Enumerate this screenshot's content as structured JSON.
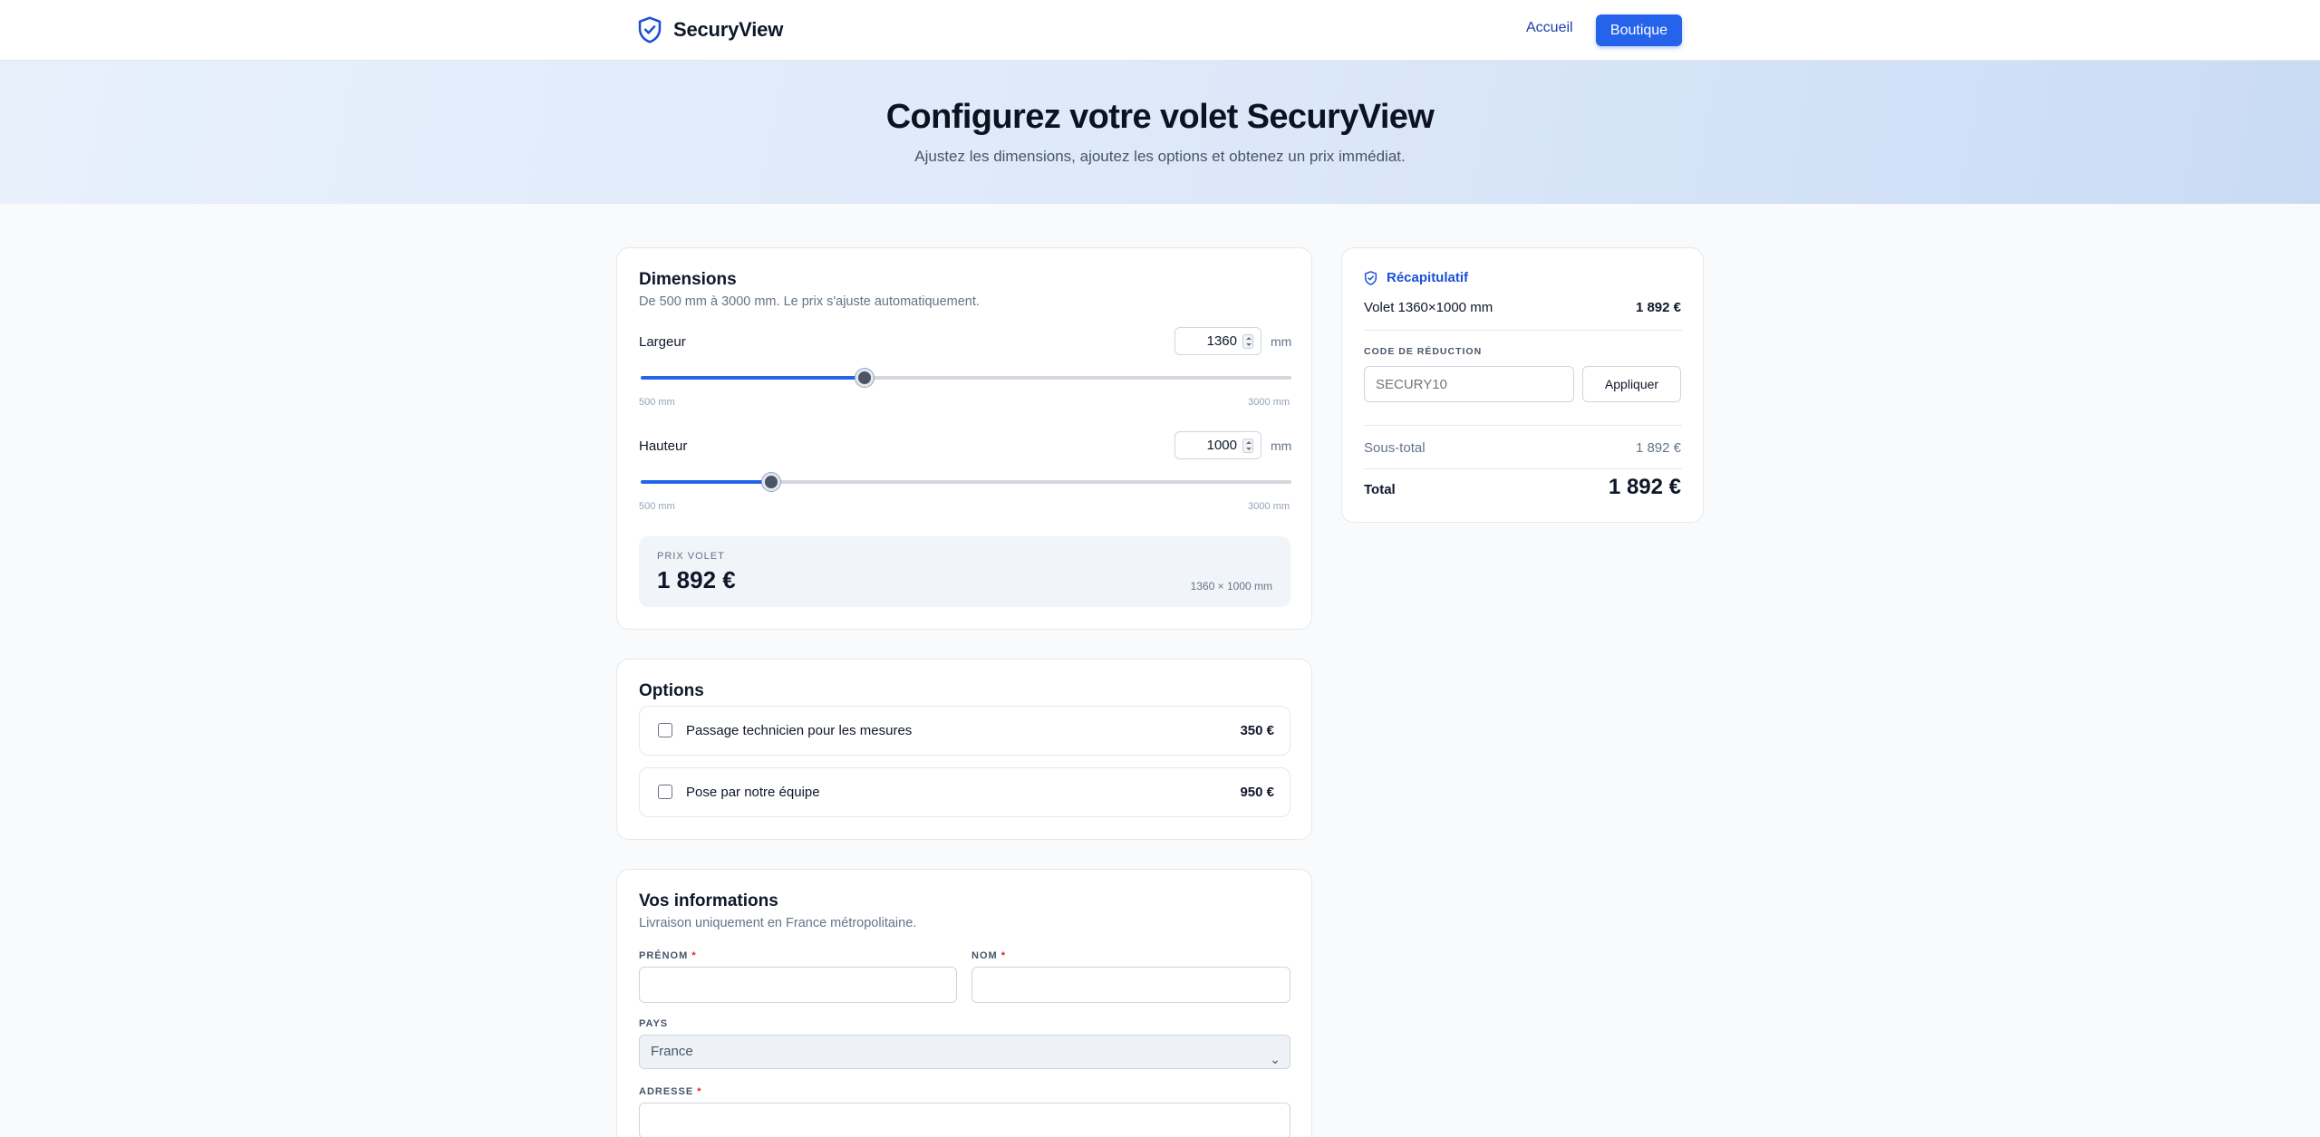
{
  "header": {
    "brand": "SecuryView",
    "nav_home": "Accueil",
    "nav_shop": "Boutique"
  },
  "hero": {
    "title": "Configurez votre volet SecuryView",
    "subtitle": "Ajustez les dimensions, ajoutez les options et obtenez un prix immédiat."
  },
  "dimensions": {
    "title": "Dimensions",
    "subtitle": "De 500 mm à 3000 mm. Le prix s'ajuste automatiquement.",
    "width": {
      "label": "Largeur",
      "value": "1360",
      "unit": "mm",
      "min_label": "500 mm",
      "max_label": "3000 mm",
      "value_num": 1360
    },
    "height": {
      "label": "Hauteur",
      "value": "1000",
      "unit": "mm",
      "min_label": "500 mm",
      "max_label": "3000 mm",
      "value_num": 1000
    },
    "range_min": 500,
    "range_max": 3000,
    "price_caption": "PRIX VOLET",
    "price_value": "1 892 €",
    "price_dims": "1360 × 1000 mm"
  },
  "options": {
    "title": "Options",
    "items": [
      {
        "label": "Passage technicien pour les mesures",
        "price": "350 €",
        "checked": false
      },
      {
        "label": "Pose par notre équipe",
        "price": "950 €",
        "checked": false
      }
    ]
  },
  "info": {
    "title": "Vos informations",
    "subtitle": "Livraison uniquement en France métropolitaine.",
    "first_name_label": "PRÉNOM",
    "last_name_label": "NOM",
    "required_mark": "*",
    "country_label": "PAYS",
    "country_value": "France",
    "address_label": "ADRESSE"
  },
  "summary": {
    "title": "Récapitulatif",
    "item_label": "Volet 1360×1000 mm",
    "item_price": "1 892 €",
    "code_label": "CODE DE RÉDUCTION",
    "code_placeholder": "SECURY10",
    "apply_label": "Appliquer",
    "subtotal_label": "Sous-total",
    "subtotal_value": "1 892 €",
    "total_label": "Total",
    "total_value": "1 892 €"
  },
  "colors": {
    "accent": "#2563eb",
    "brand_text": "#0f172a",
    "summary_accent": "#1d4ed8"
  }
}
